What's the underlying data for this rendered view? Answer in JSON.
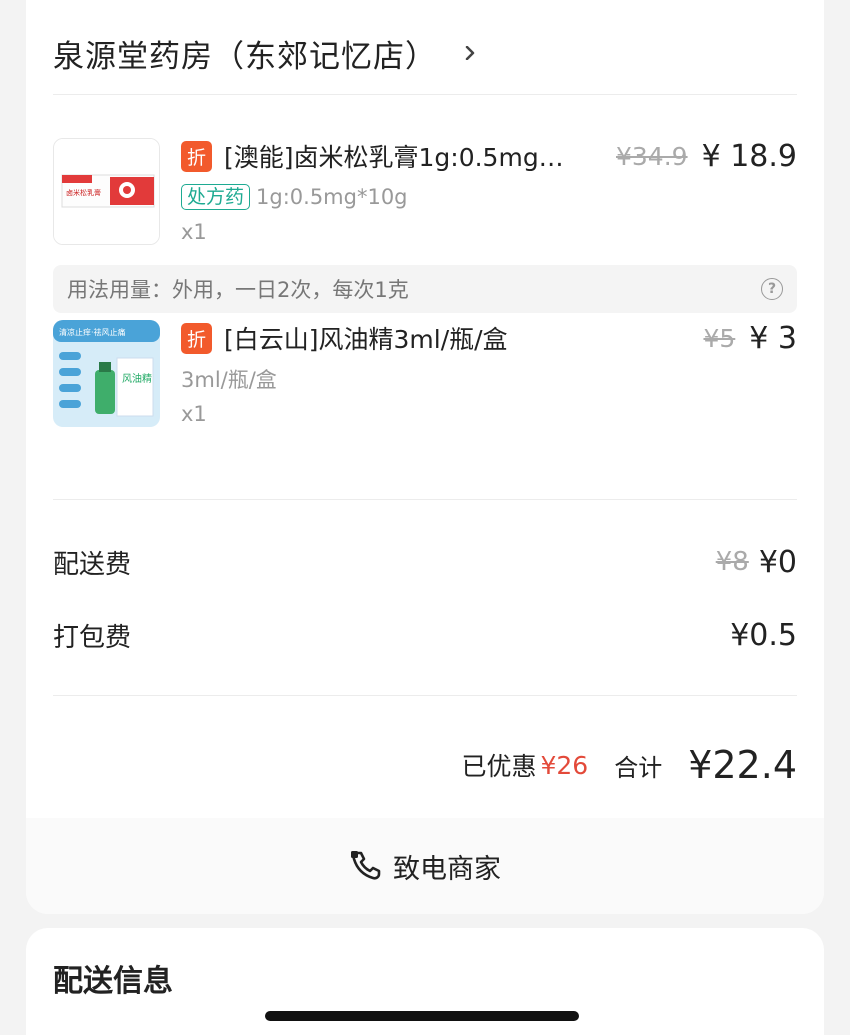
{
  "store": {
    "name": "泉源堂药房（东郊记忆店）",
    "chevron_icon": "chevron-right-icon"
  },
  "items": [
    {
      "badge": "折",
      "title": "[澳能]卤米松乳膏1g:0.5mg…",
      "original_price": "¥34.9",
      "price": "¥ 18.9",
      "tag": "处方药",
      "spec": "1g:0.5mg*10g",
      "quantity": "x1",
      "image_label": "卤米松乳膏"
    },
    {
      "badge": "折",
      "title": "[白云山]风油精3ml/瓶/盒",
      "original_price": "¥5",
      "price": "¥ 3",
      "spec": "3ml/瓶/盒",
      "quantity": "x1",
      "image_label": "清凉止痒·祛风止痛",
      "image_label2": "风油精"
    }
  ],
  "usage": {
    "text": "用法用量：外用，一日2次，每次1克",
    "help_icon": "question-circle-icon"
  },
  "fees": {
    "delivery_label": "配送费",
    "delivery_original": "¥8",
    "delivery_value": "¥0",
    "packing_label": "打包费",
    "packing_value": "¥0.5"
  },
  "summary": {
    "saved_label": "已优惠",
    "saved_amount": "¥26",
    "total_label": "合计",
    "total_value": "¥22.4"
  },
  "call": {
    "label": "致电商家",
    "icon": "phone-icon"
  },
  "delivery_section": {
    "title": "配送信息"
  },
  "colors": {
    "discount_badge": "#f25a2c",
    "rx_tag": "#1eaa92",
    "saved_amount": "#e34a3a"
  }
}
